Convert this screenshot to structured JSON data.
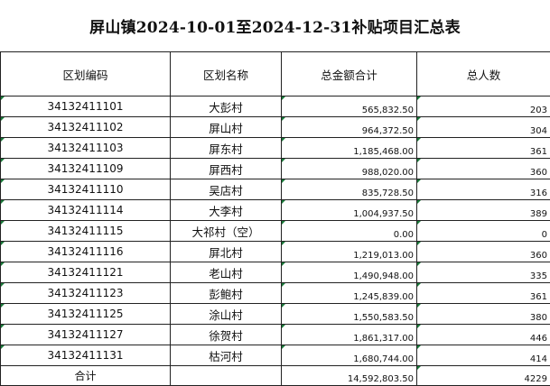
{
  "title": "屏山镇2024-10-01至2024-12-31补贴项目汇总表",
  "columns": [
    "区划编码",
    "区划名称",
    "总金额合计",
    "总人数"
  ],
  "rows": [
    {
      "code": "34132411101",
      "name": "大彭村",
      "amount": "565,832.50",
      "count": "203"
    },
    {
      "code": "34132411102",
      "name": "屏山村",
      "amount": "964,372.50",
      "count": "304"
    },
    {
      "code": "34132411103",
      "name": "屏东村",
      "amount": "1,185,468.00",
      "count": "361"
    },
    {
      "code": "34132411109",
      "name": "屏西村",
      "amount": "988,020.00",
      "count": "360"
    },
    {
      "code": "34132411110",
      "name": "吴店村",
      "amount": "835,728.50",
      "count": "316"
    },
    {
      "code": "34132411114",
      "name": "大李村",
      "amount": "1,004,937.50",
      "count": "389"
    },
    {
      "code": "34132411115",
      "name": "大祁村（空）",
      "amount": "0.00",
      "count": "0"
    },
    {
      "code": "34132411116",
      "name": "屏北村",
      "amount": "1,219,013.00",
      "count": "360"
    },
    {
      "code": "34132411121",
      "name": "老山村",
      "amount": "1,490,948.00",
      "count": "335"
    },
    {
      "code": "34132411123",
      "name": "彭鲍村",
      "amount": "1,245,839.00",
      "count": "361"
    },
    {
      "code": "34132411125",
      "name": "涂山村",
      "amount": "1,550,583.50",
      "count": "380"
    },
    {
      "code": "34132411127",
      "name": "徐贺村",
      "amount": "1,861,317.00",
      "count": "446"
    },
    {
      "code": "34132411131",
      "name": "枯河村",
      "amount": "1,680,744.00",
      "count": "414"
    }
  ],
  "total": {
    "label": "合计",
    "amount": "14,592,803.50",
    "count": "4229"
  },
  "colors": {
    "cell_marker": "#1a7a3a",
    "grid_line": "#222222"
  }
}
